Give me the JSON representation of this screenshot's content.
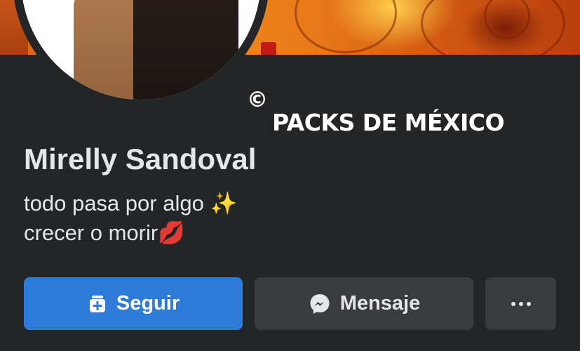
{
  "profile": {
    "name": "Mirelly Sandoval",
    "bio_line_1": "todo pasa por algo",
    "bio_line_1_emoji": "✨",
    "bio_line_2": "crecer o morir",
    "bio_line_2_emoji": "💋"
  },
  "watermark": {
    "symbol": "©",
    "text": "PACKS DE MÉXICO"
  },
  "actions": {
    "follow_label": "Seguir",
    "message_label": "Mensaje",
    "more_icon": "more-dots-icon"
  },
  "colors": {
    "background": "#242526",
    "primary_button": "#2d7ad9",
    "secondary_button": "#3a3b3c",
    "text": "#e4e6eb"
  }
}
